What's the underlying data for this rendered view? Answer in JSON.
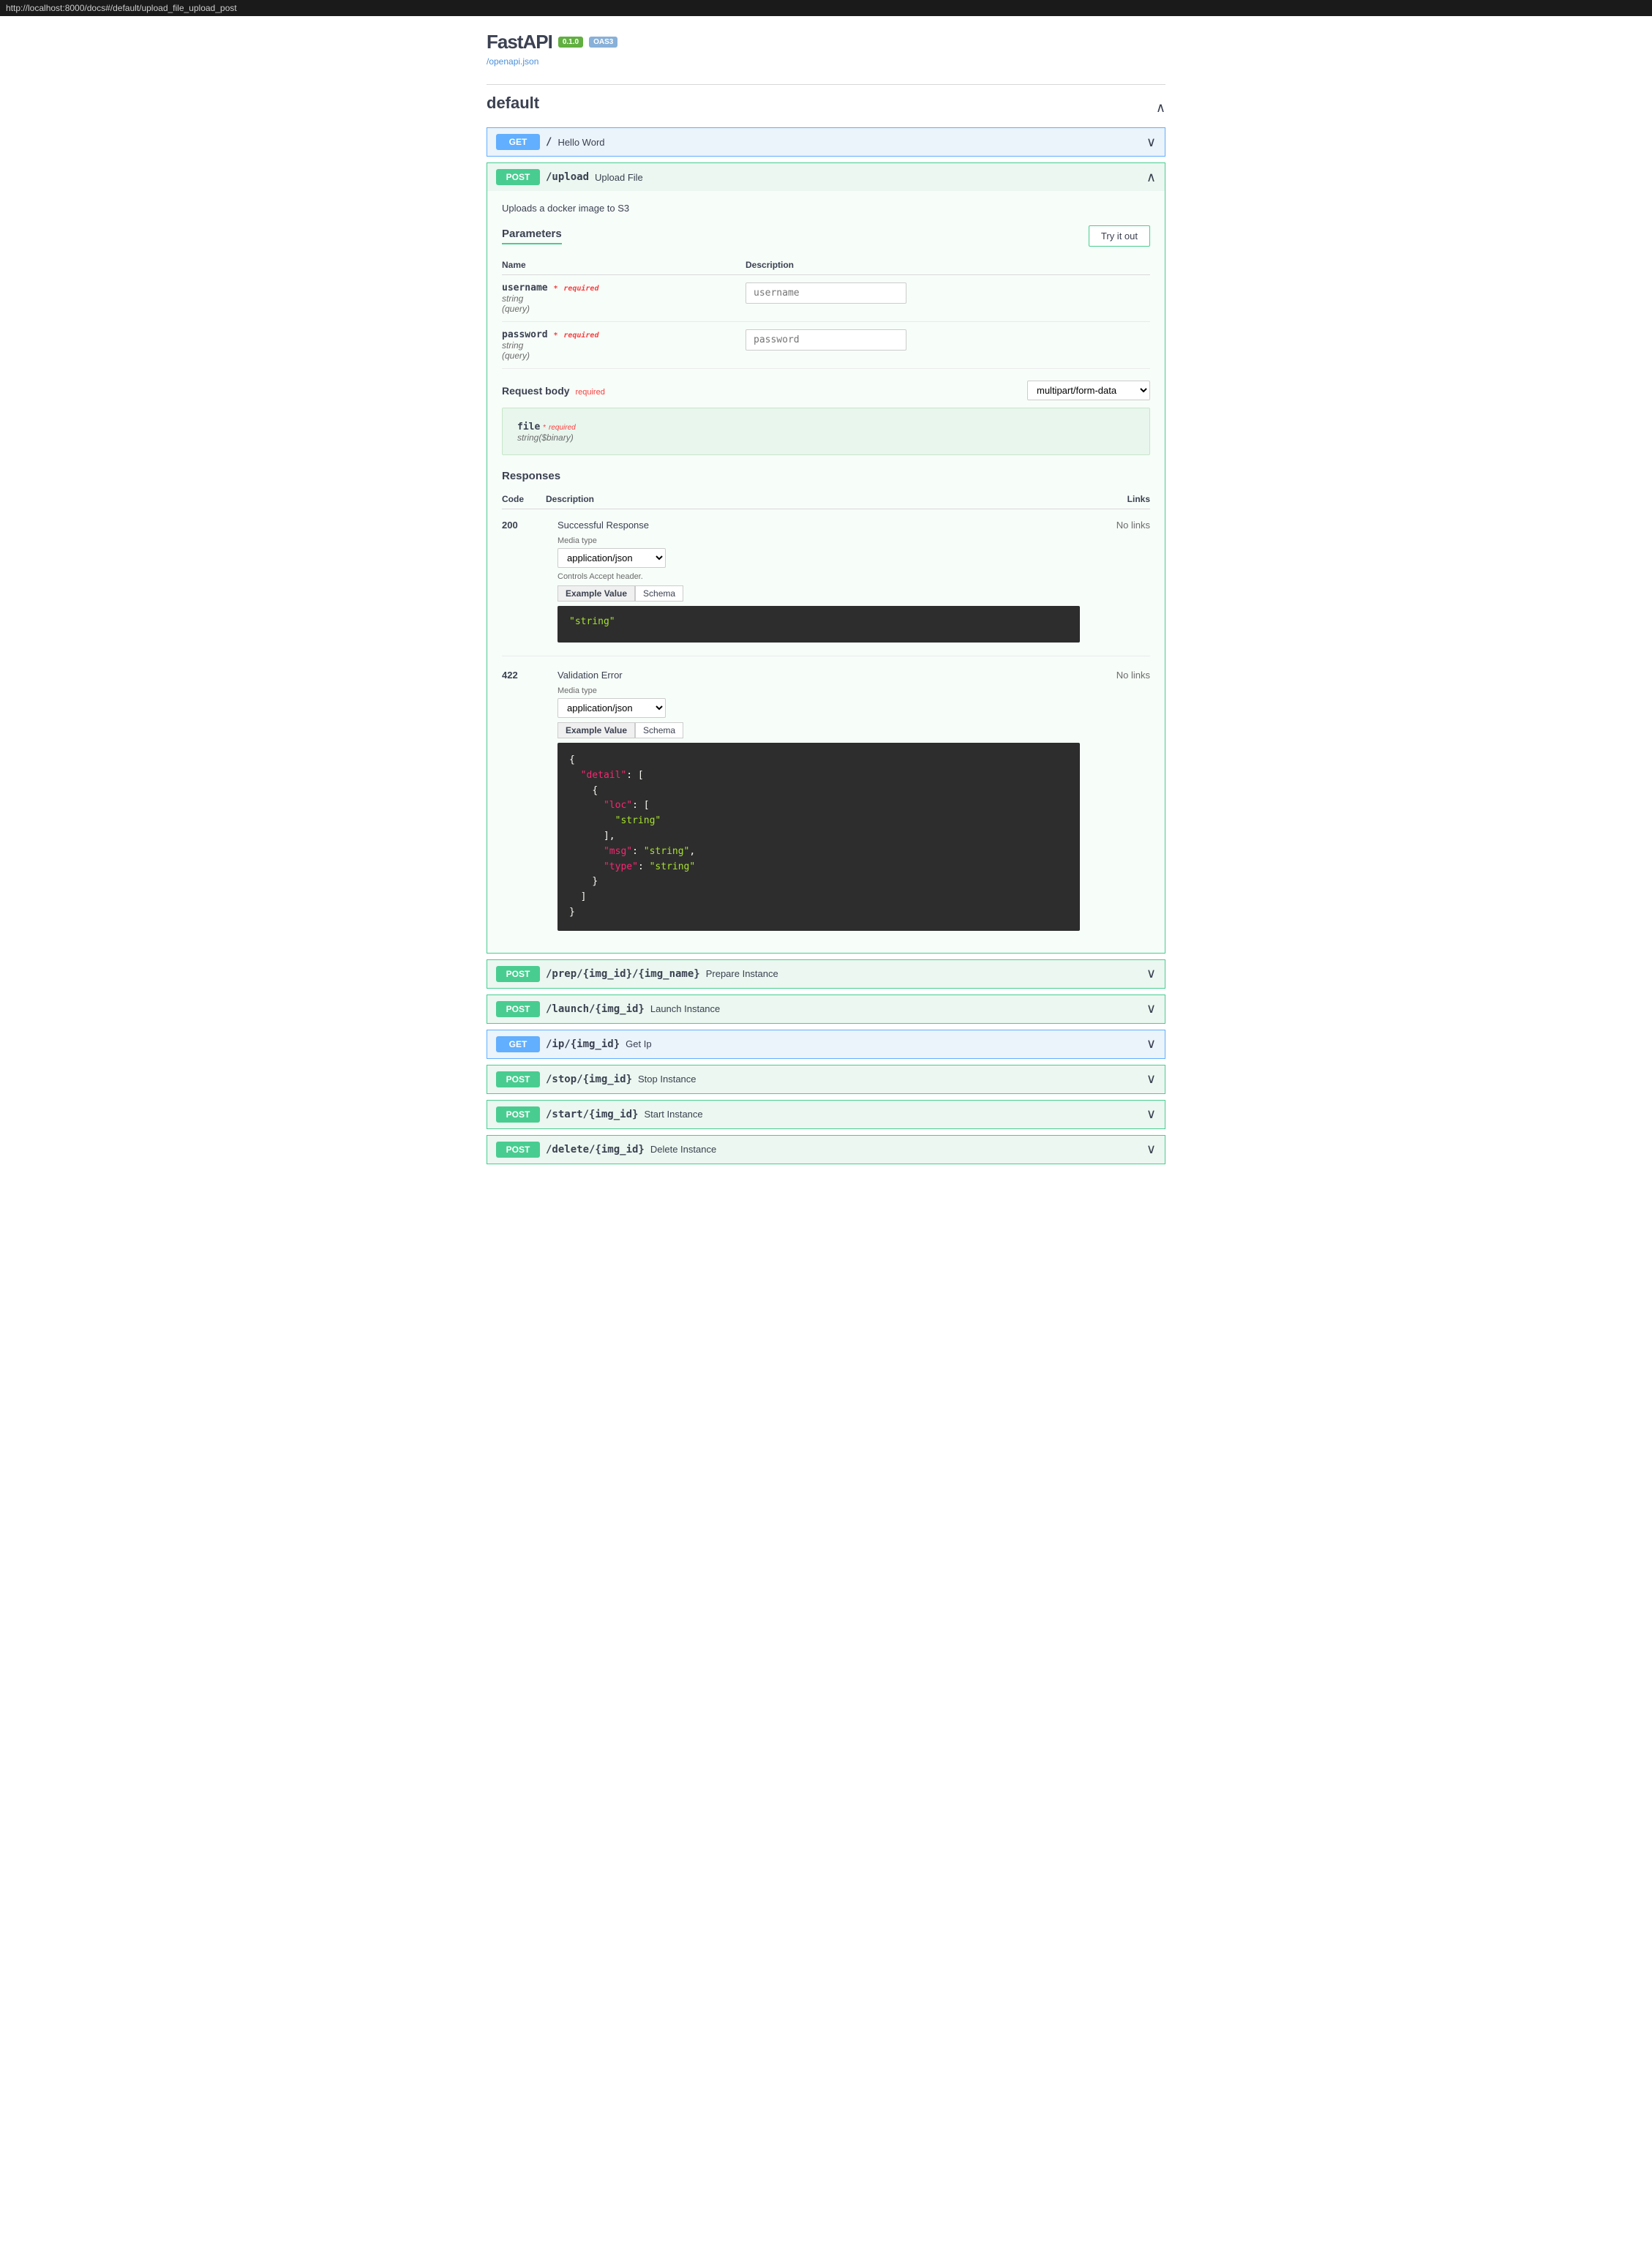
{
  "topBar": {
    "url": "http://localhost:8000/docs#/default/upload_file_upload_post"
  },
  "header": {
    "logo": "FastAPI",
    "badge1": "0.1.0",
    "badge2": "OAS3",
    "openapiLink": "/openapi.json"
  },
  "section": {
    "title": "default",
    "collapseIcon": "∧"
  },
  "endpoints": [
    {
      "method": "GET",
      "path": "/",
      "summary": "Hello Word",
      "expanded": false
    },
    {
      "method": "POST",
      "path": "/upload",
      "summary": "Upload File",
      "expanded": true,
      "description": "Uploads a docker image to S3",
      "parameters": {
        "title": "Parameters",
        "tryItOut": "Try it out",
        "columns": [
          "Name",
          "Description"
        ],
        "items": [
          {
            "name": "username",
            "required": true,
            "requiredLabel": "required",
            "type": "string",
            "meta": "(query)",
            "placeholder": "username"
          },
          {
            "name": "password",
            "required": true,
            "requiredLabel": "required",
            "type": "string",
            "meta": "(query)",
            "placeholder": "password"
          }
        ]
      },
      "requestBody": {
        "title": "Request body",
        "required": "required",
        "contentType": "multipart/form-data",
        "file": {
          "name": "file",
          "required": true,
          "requiredLabel": "required",
          "type": "string($binary)"
        }
      },
      "responses": {
        "title": "Responses",
        "columns": [
          "Code",
          "Description",
          "Links"
        ],
        "items": [
          {
            "code": "200",
            "description": "Successful Response",
            "links": "No links",
            "mediaType": "application/json",
            "acceptNote": "Controls Accept header.",
            "exampleValue": "\"string\"",
            "schemaTab": "Schema"
          },
          {
            "code": "422",
            "description": "Validation Error",
            "links": "No links",
            "mediaType": "application/json",
            "acceptNote": "",
            "exampleValue": "{\n  \"detail\": [\n    {\n      \"loc\": [\n        \"string\"\n      ],\n      \"msg\": \"string\",\n      \"type\": \"string\"\n    }\n  ]\n}",
            "schemaTab": "Schema"
          }
        ]
      }
    },
    {
      "method": "POST",
      "path": "/prep/{img_id}/{img_name}",
      "summary": "Prepare Instance",
      "expanded": false
    },
    {
      "method": "POST",
      "path": "/launch/{img_id}",
      "summary": "Launch Instance",
      "expanded": false
    },
    {
      "method": "GET",
      "path": "/ip/{img_id}",
      "summary": "Get Ip",
      "expanded": false
    },
    {
      "method": "POST",
      "path": "/stop/{img_id}",
      "summary": "Stop Instance",
      "expanded": false
    },
    {
      "method": "POST",
      "path": "/start/{img_id}",
      "summary": "Start Instance",
      "expanded": false
    },
    {
      "method": "POST",
      "path": "/delete/{img_id}",
      "summary": "Delete Instance",
      "expanded": false
    }
  ]
}
